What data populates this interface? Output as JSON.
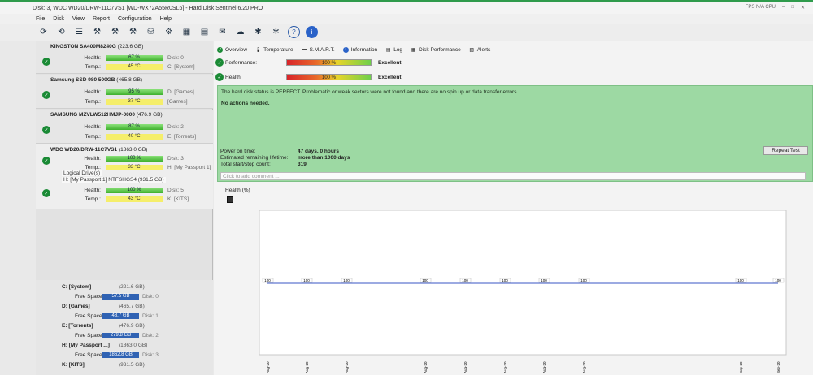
{
  "window": {
    "title": "Disk: 3, WDC WD20/DRW-11C7VS1 [WD-WX72A55R0SL6]  -  Hard Disk Sentinel 6.20 PRO",
    "right_status": "FPS N/A  CPU"
  },
  "menu": [
    "File",
    "Disk",
    "View",
    "Report",
    "Configuration",
    "Help"
  ],
  "toolbar_icons": [
    "refresh-icon",
    "refresh-all-icon",
    "disk-list-icon",
    "test-icon",
    "test2-icon",
    "test3-icon",
    "drive-icon",
    "options-icon",
    "calendar-icon",
    "export-icon",
    "email-icon",
    "weather-icon",
    "settings-icon",
    "settings2-icon",
    "help-icon",
    "info-icon"
  ],
  "disks": [
    {
      "title": "KINGSTON SA400M8240G",
      "size": "(223.6 GB)",
      "health": "67 %",
      "temp": "45 °C",
      "disk": "Disk: 0",
      "drive": "C: [System]"
    },
    {
      "title": "Samsung SSD 980 500GB",
      "size": "(465.8 GB)",
      "health": "95 %",
      "temp": "37 °C",
      "disk": "Disk: 1",
      "drive": "D: [Games]",
      "drive2": "[Games]"
    },
    {
      "title": "SAMSUNG MZVLW512HMJP-0000",
      "size": "(476.9 GB)",
      "health": "87 %",
      "temp": "40 °C",
      "disk": "Disk: 2",
      "drive": "E: [Torrents]"
    },
    {
      "title": "WDC WD20/DRW-11C7VS1",
      "size": "(1863.0 GB)",
      "health": "100 %",
      "temp": "33 °C",
      "disk": "Disk: 3",
      "drive": "H: [My Passport 1]"
    },
    {
      "title": "",
      "size": "",
      "health": "100 %",
      "temp": "43 °C",
      "disk": "Disk: 5",
      "drive": "K: [KITS]"
    }
  ],
  "labels": {
    "health": "Health:",
    "temp": "Temp.:",
    "free_space": "Free Space"
  },
  "logical": {
    "title": "Logical Drive(s)",
    "entry": "H: [My Passport 1] NTFS",
    "overlap": "HGS4 (931.5 GB)"
  },
  "volumes": [
    {
      "name": "C: [System]",
      "size": "(221.6 GB)",
      "free": "57.5 GB",
      "disk": "Disk: 0"
    },
    {
      "name": "D: [Games]",
      "size": "(465.7 GB)",
      "free": "48.7 GB",
      "disk": "Disk: 1"
    },
    {
      "name": "E: [Torrents]",
      "size": "(476.9 GB)",
      "free": "279.8 GB",
      "disk": "Disk: 2"
    },
    {
      "name": "H: [My Passport ...]",
      "size": "(1863.0 GB)",
      "free": "1862.8 GB",
      "disk": "Disk: 3"
    },
    {
      "name": "K: [KITS]",
      "size": "(931.5 GB)",
      "free": "",
      "disk": ""
    }
  ],
  "tabs": [
    "Overview",
    "Temperature",
    "S.M.A.R.T.",
    "Information",
    "Log",
    "Disk Performance",
    "Alerts"
  ],
  "performance": {
    "label": "Performance:",
    "value": "100 %",
    "rating": "Excellent",
    "fraction": 1.0
  },
  "health": {
    "label": "Health:",
    "value": "100 %",
    "rating": "Excellent",
    "fraction": 1.0
  },
  "status_text": "The hard disk status is PERFECT. Problematic or weak sectors were not found and there are no spin up or data transfer errors.",
  "actions_text": "No actions needed.",
  "info": [
    {
      "k": "Power on time:",
      "v": "47 days, 0 hours"
    },
    {
      "k": "Estimated remaining lifetime:",
      "v": "more than 1000 days"
    },
    {
      "k": "Total start/stop count:",
      "v": "319"
    }
  ],
  "repeat_test": "Repeat Test",
  "comment_placeholder": "Click to add comment ...",
  "chart_label": "Health (%)",
  "chart_data": {
    "type": "line",
    "title": "Health (%)",
    "x": [
      "Aug-20",
      "Aug-20",
      "Aug-20",
      "Aug-20",
      "Aug-20",
      "Aug-20",
      "Aug-20",
      "Aug-20",
      "Sep-20",
      "Sep-20"
    ],
    "values": [
      100,
      100,
      100,
      100,
      100,
      100,
      100,
      100,
      100,
      100
    ],
    "ylim": [
      0,
      100
    ]
  },
  "colors": {
    "health_green": "#3fb02d",
    "status_bg": "#9dd9a3",
    "volume_blue": "#2f62b3"
  }
}
